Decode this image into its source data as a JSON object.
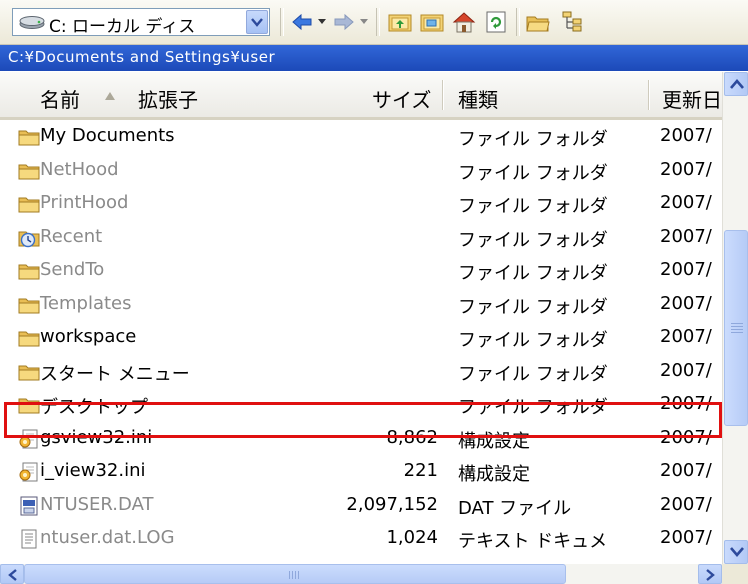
{
  "toolbar": {
    "drive_label": "C: ローカル ディス",
    "icons": [
      "drive-icon",
      "back-arrow-icon",
      "dropdown-icon",
      "forward-arrow-icon",
      "up-folder-icon",
      "folder-icon",
      "home-icon",
      "refresh-icon",
      "open-folder-icon",
      "tree-view-icon"
    ]
  },
  "path": "C:¥Documents and Settings¥user",
  "columns": {
    "name": "名前",
    "ext": "拡張子",
    "size": "サイズ",
    "type": "種類",
    "modified": "更新日"
  },
  "files": [
    {
      "name": "My Documents",
      "size": "",
      "type": "ファイル フォルダ",
      "date": "2007/",
      "icon": "folder",
      "hidden": false
    },
    {
      "name": "NetHood",
      "size": "",
      "type": "ファイル フォルダ",
      "date": "2007/",
      "icon": "folder",
      "hidden": true
    },
    {
      "name": "PrintHood",
      "size": "",
      "type": "ファイル フォルダ",
      "date": "2007/",
      "icon": "folder",
      "hidden": true
    },
    {
      "name": "Recent",
      "size": "",
      "type": "ファイル フォルダ",
      "date": "2007/",
      "icon": "recent",
      "hidden": true
    },
    {
      "name": "SendTo",
      "size": "",
      "type": "ファイル フォルダ",
      "date": "2007/",
      "icon": "folder",
      "hidden": true
    },
    {
      "name": "Templates",
      "size": "",
      "type": "ファイル フォルダ",
      "date": "2007/",
      "icon": "folder",
      "hidden": true
    },
    {
      "name": "workspace",
      "size": "",
      "type": "ファイル フォルダ",
      "date": "2007/",
      "icon": "folder",
      "hidden": false
    },
    {
      "name": "スタート メニュー",
      "size": "",
      "type": "ファイル フォルダ",
      "date": "2007/",
      "icon": "folder",
      "hidden": false
    },
    {
      "name": "デスクトップ",
      "size": "",
      "type": "ファイル フォルダ",
      "date": "2007/",
      "icon": "folder",
      "hidden": false
    },
    {
      "name": "gsview32.ini",
      "size": "8,862",
      "type": "構成設定",
      "date": "2007/",
      "icon": "ini",
      "hidden": false
    },
    {
      "name": "i_view32.ini",
      "size": "221",
      "type": "構成設定",
      "date": "2007/",
      "icon": "ini",
      "hidden": false
    },
    {
      "name": "NTUSER.DAT",
      "size": "2,097,152",
      "type": "DAT ファイル",
      "date": "2007/",
      "icon": "dat",
      "hidden": true
    },
    {
      "name": "ntuser.dat.LOG",
      "size": "1,024",
      "type": "テキスト ドキュメ",
      "date": "2007/",
      "icon": "txt",
      "hidden": true
    }
  ],
  "highlighted_row": "デスクトップ",
  "colors": {
    "accent": "#2a5fd0",
    "highlight": "#e01010",
    "folder": "#f2cf6a"
  }
}
